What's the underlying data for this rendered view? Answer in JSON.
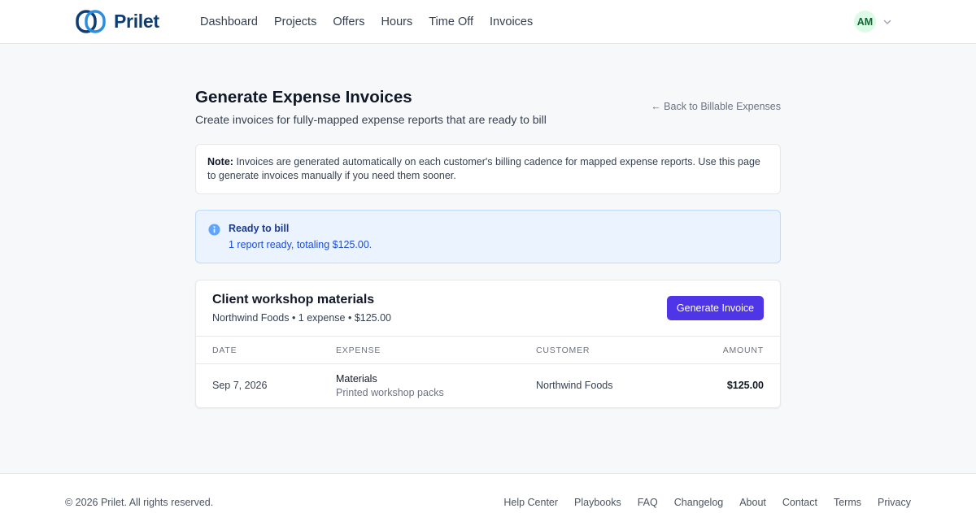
{
  "brand": {
    "name": "Prilet",
    "color": "#0f3d73"
  },
  "nav": {
    "items": [
      "Dashboard",
      "Projects",
      "Offers",
      "Hours",
      "Time Off",
      "Invoices"
    ]
  },
  "user": {
    "initials": "AM"
  },
  "page": {
    "title": "Generate Expense Invoices",
    "subtitle": "Create invoices for fully-mapped expense reports that are ready to bill",
    "back_link": "← Back to Billable Expenses"
  },
  "note": {
    "label": "Note:",
    "text": "Invoices are generated automatically on each customer's billing cadence for mapped expense reports. Use this page to generate invoices manually if you need them sooner."
  },
  "info": {
    "icon": "info-icon",
    "title": "Ready to bill",
    "text": "1 report ready, totaling $125.00."
  },
  "report": {
    "title": "Client workshop materials",
    "meta": "Northwind Foods • 1 expense • $125.00",
    "button_label": "Generate Invoice",
    "accent": "#4f35e8",
    "columns": [
      "DATE",
      "EXPENSE",
      "CUSTOMER",
      "AMOUNT"
    ],
    "rows": [
      {
        "date": "Sep 7, 2026",
        "expense": "Materials",
        "description": "Printed workshop packs",
        "customer": "Northwind Foods",
        "amount": "$125.00"
      }
    ]
  },
  "footer": {
    "copyright": "© 2026 Prilet. All rights reserved.",
    "links": [
      "Help Center",
      "Playbooks",
      "FAQ",
      "Changelog",
      "About",
      "Contact",
      "Terms",
      "Privacy"
    ]
  }
}
